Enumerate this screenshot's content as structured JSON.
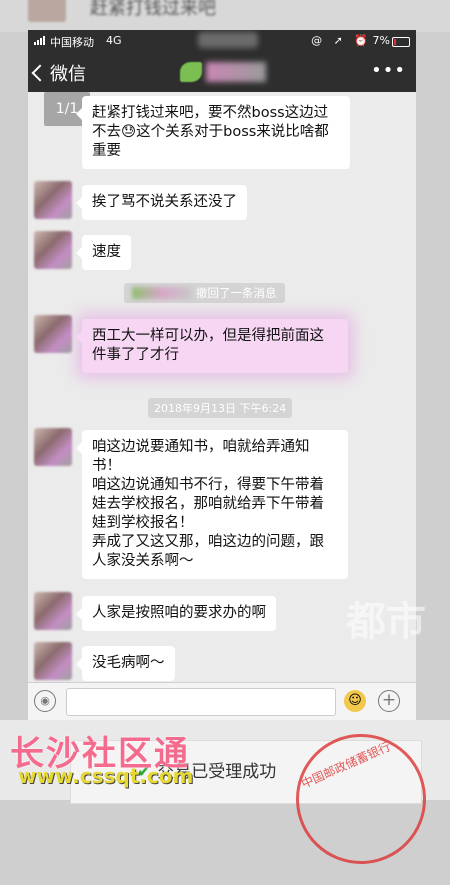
{
  "status_bar": {
    "carrier": "中国移动",
    "network": "4G",
    "icons": "@ ➚ ⏰",
    "battery": "7%"
  },
  "nav": {
    "back_label": "微信",
    "more_label": "•••"
  },
  "pager": "1/1",
  "messages": [
    {
      "text": "赶紧打钱过来吧，要不然boss这边过不去😓这个关系对于boss来说比啥都重要"
    },
    {
      "text": "挨了骂不说关系还没了"
    },
    {
      "text": "速度"
    },
    {
      "text": "西工大一样可以办，但是得把前面这件事了了才行"
    },
    {
      "text": "咱这边说要通知书，咱就给弄通知书！\n咱这边说通知书不行，得要下午带着娃去学校报名，那咱就给弄下午带着娃到学校报名！\n弄成了又这又那，咱这边的问题，跟人家没关系啊～"
    },
    {
      "text": "人家是按照咱的要求办的啊"
    },
    {
      "text": "没毛病啊～"
    }
  ],
  "system_notice": "撤回了一条消息",
  "timestamp": "2018年9月13日 下午6:24",
  "receipt": {
    "status": "交易已受理成功",
    "stamp_text": "中国邮政储蓄银行"
  },
  "watermark": {
    "site_cn": "长沙社区通",
    "site_url": "www.cssqt.com",
    "side_text": "都市"
  }
}
